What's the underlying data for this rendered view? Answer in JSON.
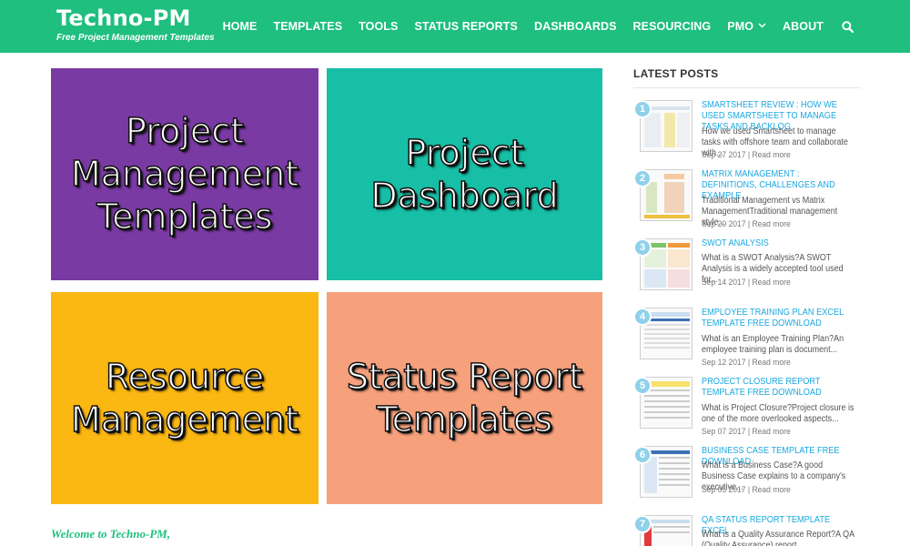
{
  "header": {
    "brand_title": "Techno-PM",
    "brand_tagline": "Free Project Management Templates",
    "nav": [
      {
        "label": "HOME"
      },
      {
        "label": "TEMPLATES"
      },
      {
        "label": "TOOLS"
      },
      {
        "label": "STATUS REPORTS"
      },
      {
        "label": "DASHBOARDS"
      },
      {
        "label": "RESOURCING"
      },
      {
        "label": "PMO"
      },
      {
        "label": "ABOUT"
      }
    ],
    "search_icon": "search-icon",
    "colors": {
      "header_bg": "#1ebf7f",
      "text": "#ffffff"
    }
  },
  "tiles": [
    {
      "label": "Project\nManagement\nTemplates",
      "color": "#7a3aa4"
    },
    {
      "label": "Project\nDashboard",
      "color": "#17bfa6"
    },
    {
      "label": "Resource\nManagement",
      "color": "#fbb712"
    },
    {
      "label": "Status Report\nTemplates",
      "color": "#f7a07c"
    }
  ],
  "welcome": "Welcome to Techno-PM,",
  "sidebar": {
    "title": "LATEST POSTS",
    "posts": [
      {
        "num": "1",
        "title": "SMARTSHEET REVIEW : HOW WE USED SMARTSHEET TO MANAGE TASKS AND BACKLOG",
        "excerpt": "How we used Smartsheet to manage tasks with offshore team and collaborate with...",
        "meta": "Sep 27 2017 | Read more"
      },
      {
        "num": "2",
        "title": "MATRIX MANAGEMENT : DEFINITIONS, CHALLENGES AND EXAMPLE",
        "excerpt": "Traditional Management vs Matrix ManagementTraditional management style...",
        "meta": "Sep 20 2017 | Read more"
      },
      {
        "num": "3",
        "title": "SWOT ANALYSIS",
        "excerpt": "What is a SWOT Analysis?A SWOT Analysis is a widely accepted tool used for...",
        "meta": "Sep 14 2017 | Read more"
      },
      {
        "num": "4",
        "title": "EMPLOYEE TRAINING PLAN EXCEL TEMPLATE FREE DOWNLOAD",
        "excerpt": "What is an Employee Training Plan?An employee training plan is document...",
        "meta": "Sep 12 2017 | Read more"
      },
      {
        "num": "5",
        "title": "PROJECT CLOSURE REPORT TEMPLATE FREE DOWNLOAD",
        "excerpt": "What is Project Closure?Project closure is one of the more overlooked aspects...",
        "meta": "Sep 07 2017 | Read more"
      },
      {
        "num": "6",
        "title": "BUSINESS CASE TEMPLATE FREE DOWNLOAD",
        "excerpt": "What is a Business Case?A good Business Case explains to a company's executive...",
        "meta": "Sep 05 2017 | Read more"
      },
      {
        "num": "7",
        "title": "QA STATUS REPORT TEMPLATE EXCEL",
        "excerpt": "What is a Quality Assurance Report?A QA (Quality Assurance) report...",
        "meta": ""
      }
    ]
  }
}
